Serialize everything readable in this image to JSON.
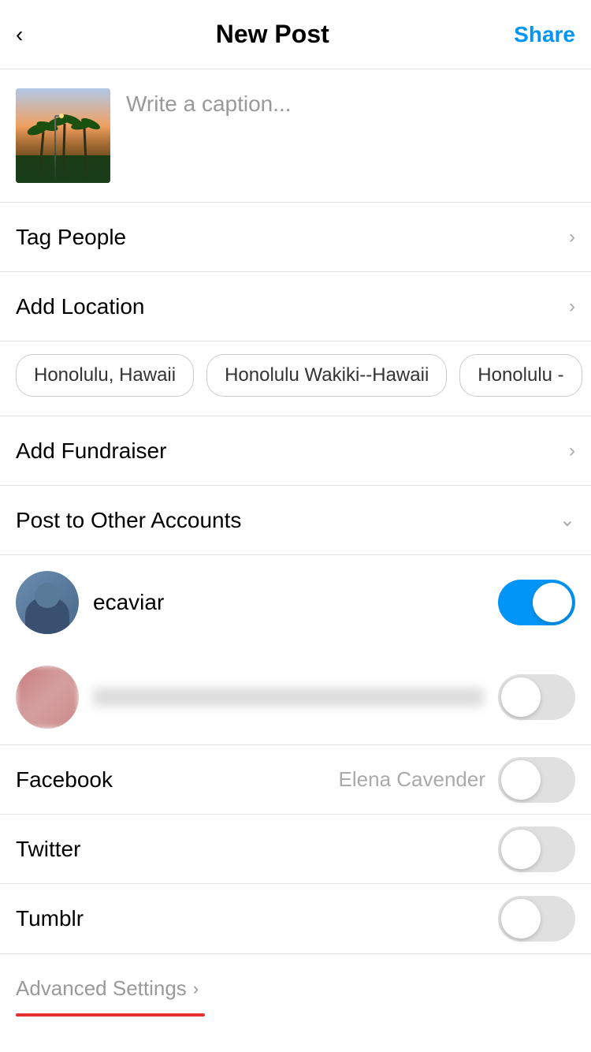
{
  "header": {
    "back_label": "‹",
    "title": "New Post",
    "share_label": "Share"
  },
  "caption": {
    "placeholder": "Write a caption..."
  },
  "menu_items": [
    {
      "id": "tag-people",
      "label": "Tag People",
      "chevron": "›"
    },
    {
      "id": "add-location",
      "label": "Add Location",
      "chevron": "›"
    },
    {
      "id": "add-fundraiser",
      "label": "Add Fundraiser",
      "chevron": "›"
    }
  ],
  "location_tags": [
    {
      "id": "honolulu-hawaii",
      "label": "Honolulu, Hawaii"
    },
    {
      "id": "honolulu-wakiki",
      "label": "Honolulu Wakiki--Hawaii"
    },
    {
      "id": "honolulu-3",
      "label": "Honolulu -"
    }
  ],
  "post_to_other_accounts": {
    "label": "Post to Other Accounts",
    "chevron": "⌄"
  },
  "accounts": [
    {
      "id": "ecaviar",
      "name": "ecaviar",
      "toggled": true,
      "blurred": false
    },
    {
      "id": "account2",
      "name": "",
      "toggled": false,
      "blurred": true
    }
  ],
  "social_sharing": [
    {
      "id": "facebook",
      "label": "Facebook",
      "username": "Elena Cavender",
      "toggled": false
    },
    {
      "id": "twitter",
      "label": "Twitter",
      "username": "",
      "toggled": false
    },
    {
      "id": "tumblr",
      "label": "Tumblr",
      "username": "",
      "toggled": false
    }
  ],
  "advanced_settings": {
    "label": "Advanced Settings",
    "chevron": "›"
  },
  "colors": {
    "blue": "#0095f6",
    "red": "#e63030",
    "gray": "#999",
    "border": "#e0e0e0"
  }
}
